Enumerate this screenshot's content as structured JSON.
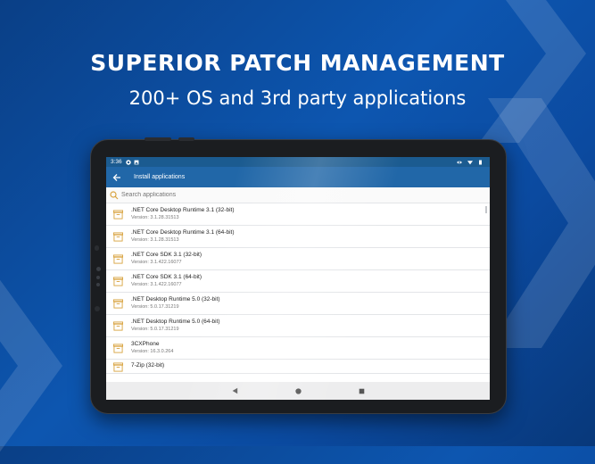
{
  "hero": {
    "headline": "SUPERIOR PATCH MANAGEMENT",
    "subline": "200+ OS and 3rd party applications"
  },
  "status_bar": {
    "time": "3:36",
    "left_icons": [
      "sync-icon",
      "image-icon"
    ],
    "right_icons": [
      "data-transfer-icon",
      "wifi-icon",
      "battery-icon"
    ]
  },
  "app_bar": {
    "title": "Install applications",
    "back_icon": "back-arrow-icon"
  },
  "search": {
    "placeholder": "Search applications",
    "icon": "search-icon"
  },
  "applications": [
    {
      "name": ".NET Core Desktop Runtime 3.1 (32-bit)",
      "version": "Version: 3.1.28.31513"
    },
    {
      "name": ".NET Core Desktop Runtime 3.1 (64-bit)",
      "version": "Version: 3.1.28.31513"
    },
    {
      "name": ".NET Core SDK 3.1 (32-bit)",
      "version": "Version: 3.1.422.16077"
    },
    {
      "name": ".NET Core SDK 3.1 (64-bit)",
      "version": "Version: 3.1.422.16077"
    },
    {
      "name": ".NET Desktop Runtime 5.0 (32-bit)",
      "version": "Version: 5.0.17.31219"
    },
    {
      "name": ".NET Desktop Runtime 5.0 (64-bit)",
      "version": "Version: 5.0.17.31219"
    },
    {
      "name": "3CXPhone",
      "version": "Version: 16.3.0.264"
    },
    {
      "name": "7-Zip (32-bit)",
      "version": ""
    }
  ],
  "nav_bar": {
    "icons": [
      "back-nav-icon",
      "home-nav-icon",
      "recents-nav-icon"
    ]
  },
  "colors": {
    "background": "#0d56b0",
    "status_bar": "#1b5b90",
    "app_bar": "#2167a8",
    "package_icon": "#d9a441"
  }
}
